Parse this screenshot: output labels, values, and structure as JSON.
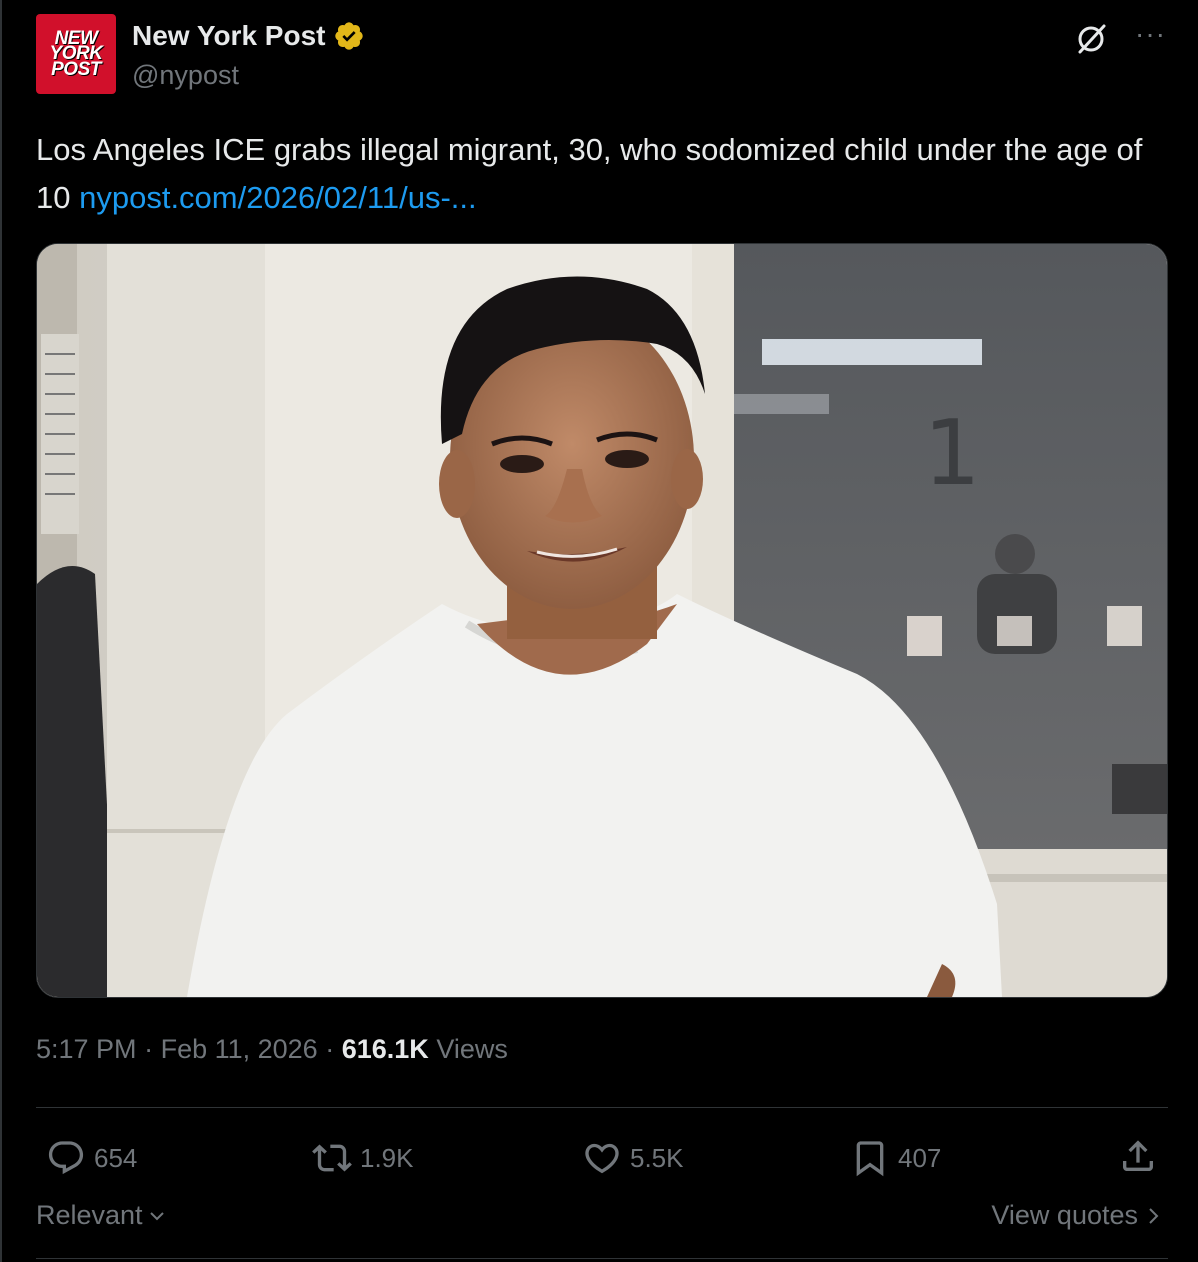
{
  "account": {
    "logo_lines": [
      "NEW",
      "YORK",
      "POST"
    ],
    "name": "New York Post",
    "handle": "@nypost",
    "verified_icon": "verified-badge-gold"
  },
  "post": {
    "text": "Los Angeles ICE grabs illegal migrant, 30, who sodomized child under the age of 10 ",
    "link": "nypost.com/2026/02/11/us-..."
  },
  "media": {
    "wall_number": "1"
  },
  "meta": {
    "time": "5:17 PM",
    "date": "Feb 11, 2026",
    "views_count": "616.1K",
    "views_label": "Views"
  },
  "actions": {
    "replies": "654",
    "reposts": "1.9K",
    "likes": "5.5K",
    "bookmarks": "407"
  },
  "footer": {
    "sort_label": "Relevant",
    "view_quotes": "View quotes"
  },
  "colors": {
    "background": "#000000",
    "text": "#e7e9ea",
    "muted": "#71767b",
    "link": "#1d9bf0",
    "verified": "#e2b719",
    "logo": "#d1102b"
  }
}
